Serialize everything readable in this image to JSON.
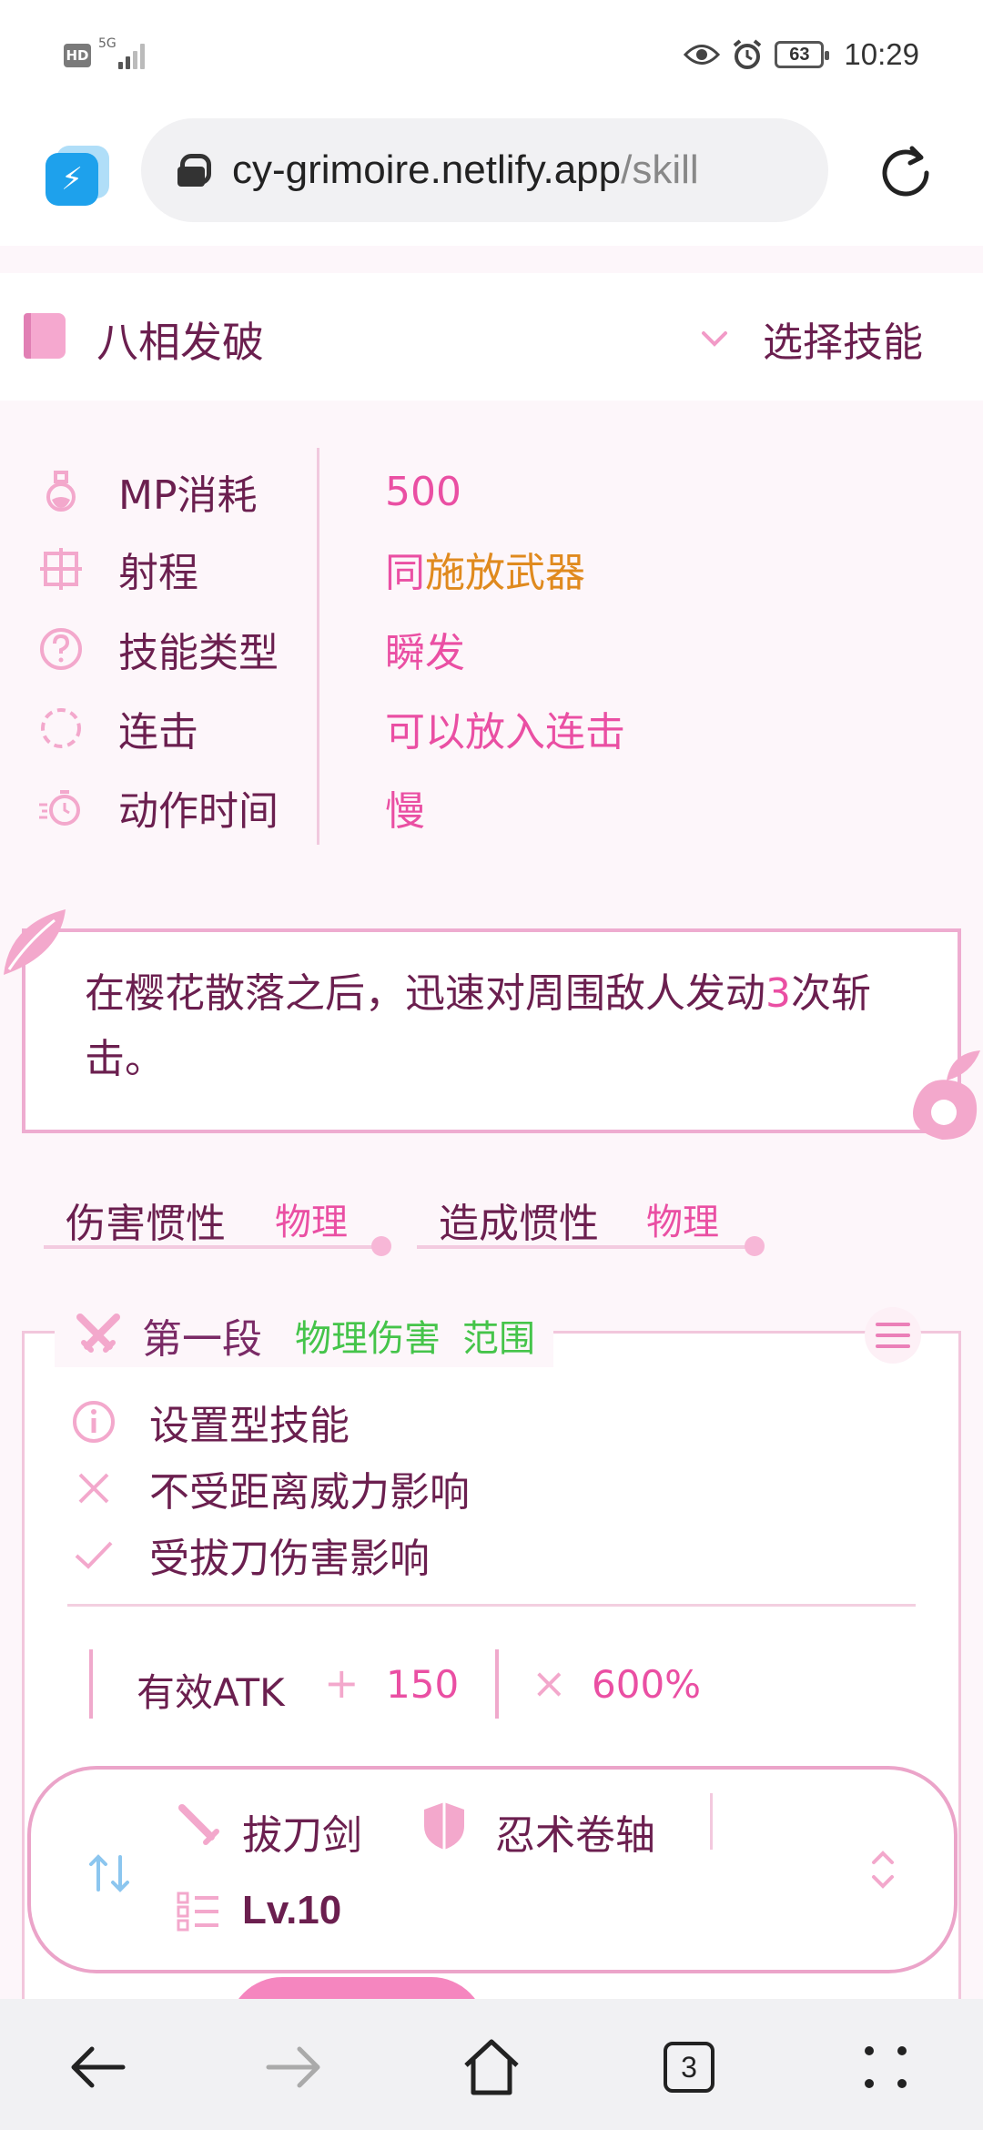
{
  "status_bar": {
    "hd": "HD",
    "network": "5G",
    "battery": "63",
    "time": "10:29"
  },
  "browser": {
    "url_host": "cy-grimoire.netlify.app",
    "url_path": "/skill",
    "tab_count": "3"
  },
  "skill": {
    "name": "八相发破",
    "select_label": "选择技能",
    "properties": [
      {
        "label": "MP消耗",
        "value": "500",
        "icon": "potion-icon"
      },
      {
        "label": "射程",
        "value_prefix": "同",
        "value": "施放武器",
        "icon": "crosshair-icon"
      },
      {
        "label": "技能类型",
        "value": "瞬发",
        "icon": "question-circle-icon"
      },
      {
        "label": "连击",
        "value": "可以放入连击",
        "icon": "dashed-circle-icon"
      },
      {
        "label": "动作时间",
        "value": "慢",
        "icon": "timer-icon"
      }
    ],
    "description": {
      "before": "在樱花散落之后，迅速对周围敌人发动",
      "number": "3",
      "after": "次斩击。"
    },
    "inertia": [
      {
        "label": "伤害惯性",
        "value": "物理"
      },
      {
        "label": "造成惯性",
        "value": "物理"
      }
    ]
  },
  "segment": {
    "title": "第一段",
    "tags": [
      "物理伤害",
      "范围"
    ],
    "features": [
      {
        "text": "设置型技能",
        "icon": "info-icon"
      },
      {
        "text": "不受距离威力影响",
        "icon": "close-icon"
      },
      {
        "text": "受拔刀伤害影响",
        "icon": "check-icon"
      }
    ],
    "formula": {
      "label": "有效ATK",
      "plus": "+",
      "constant": "150",
      "times": "×",
      "multiplier": "600%"
    }
  },
  "equipment_panel": {
    "weapon": "拔刀剑",
    "sub": "忍术卷轴",
    "level": "Lv.10"
  },
  "colors": {
    "accent": "#ea4fa3",
    "text": "#6b1f4f",
    "orange": "#e08a1e",
    "green": "#45c44a"
  }
}
